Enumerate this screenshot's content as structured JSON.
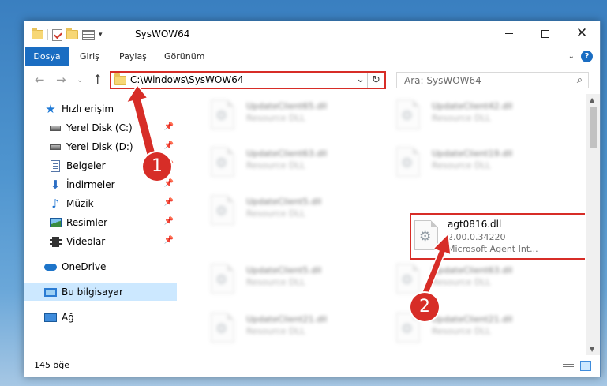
{
  "window": {
    "title": "SysWOW64"
  },
  "ribbon": {
    "tabs": [
      "Dosya",
      "Giriş",
      "Paylaş",
      "Görünüm"
    ],
    "help": "?"
  },
  "address": {
    "path": "C:\\Windows\\SysWOW64"
  },
  "search": {
    "placeholder": "Ara: SysWOW64"
  },
  "nav": {
    "items": [
      {
        "label": "Hızlı erişim",
        "icon": "star-icon",
        "pinned": false
      },
      {
        "label": "Yerel Disk (C:)",
        "icon": "drive-icon",
        "pinned": true
      },
      {
        "label": "Yerel Disk (D:)",
        "icon": "drive-icon",
        "pinned": true
      },
      {
        "label": "Belgeler",
        "icon": "documents-icon",
        "pinned": true
      },
      {
        "label": "İndirmeler",
        "icon": "download-icon",
        "pinned": true
      },
      {
        "label": "Müzik",
        "icon": "music-icon",
        "pinned": true
      },
      {
        "label": "Resimler",
        "icon": "pictures-icon",
        "pinned": true
      },
      {
        "label": "Videolar",
        "icon": "video-icon",
        "pinned": true
      },
      {
        "label": "OneDrive",
        "icon": "onedrive-icon",
        "pinned": false
      },
      {
        "label": "Bu bilgisayar",
        "icon": "pc-icon",
        "pinned": false,
        "selected": true
      },
      {
        "label": "Ağ",
        "icon": "network-icon",
        "pinned": false
      }
    ]
  },
  "files": [
    {
      "name": "UpdateClient65.dll",
      "type": "Resource DLL"
    },
    {
      "name": "UpdateClient42.dll",
      "type": "Resource DLL"
    },
    {
      "name": "UpdateClient63.dll",
      "type": "Resource DLL"
    },
    {
      "name": "UpdateClient19.dll",
      "type": "Resource DLL"
    },
    {
      "name": "UpdateClient5.dll",
      "type": "Resource DLL"
    },
    {
      "name": "agt0816.dll",
      "version": "2.00.0.34220",
      "type": "Microsoft Agent Int..."
    },
    {
      "name": "UpdateClient5.dll",
      "type": "Resource DLL"
    },
    {
      "name": "UpdateClient63.dll",
      "type": "Resource DLL"
    },
    {
      "name": "UpdateClient21.dll",
      "type": "Resource DLL"
    },
    {
      "name": "UpdateClient21.dll",
      "type": "Resource DLL"
    }
  ],
  "status": {
    "count": "145 öğe"
  },
  "annotations": {
    "badge1": "1",
    "badge2": "2",
    "color": "#d72d27"
  }
}
